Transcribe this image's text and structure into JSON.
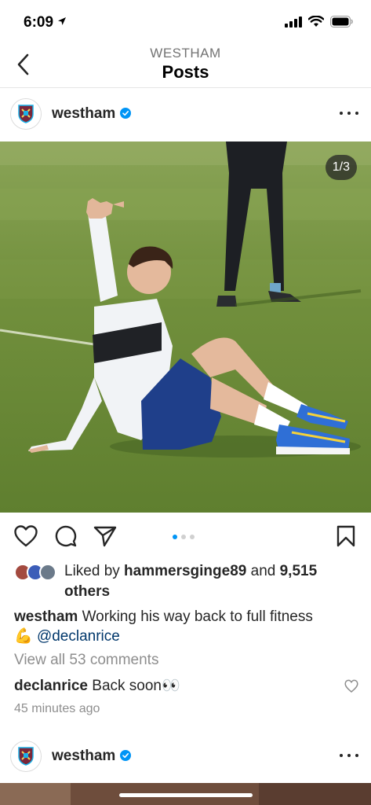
{
  "status": {
    "time": "6:09"
  },
  "nav": {
    "subtitle": "WESTHAM",
    "title": "Posts"
  },
  "post": {
    "username": "westham",
    "counter": "1/3",
    "likes": {
      "prefix": "Liked by ",
      "user": "hammersginge89",
      "middle": " and ",
      "count": "9,515",
      "suffix": "others"
    },
    "caption": {
      "username": "westham",
      "text": " Working his way back to full fitness",
      "emoji": "💪",
      "mention": "@declanrice"
    },
    "view_comments": "View all 53 comments",
    "comment": {
      "username": "declanrice",
      "text": " Back soon👀"
    },
    "time_ago": "45 minutes ago",
    "carousel": {
      "total": 3,
      "active": 0
    }
  },
  "next_post": {
    "username": "westham"
  },
  "colors": {
    "accent": "#0095f6",
    "verified": "#0095f6",
    "grass": "#6f8f3a",
    "mention": "#00376b"
  },
  "icons": {
    "back": "chevron-left-icon",
    "like": "heart-icon",
    "comment": "comment-bubble-icon",
    "share": "paper-plane-icon",
    "save": "bookmark-icon",
    "more": "ellipsis-icon",
    "verified": "verified-badge-icon"
  }
}
